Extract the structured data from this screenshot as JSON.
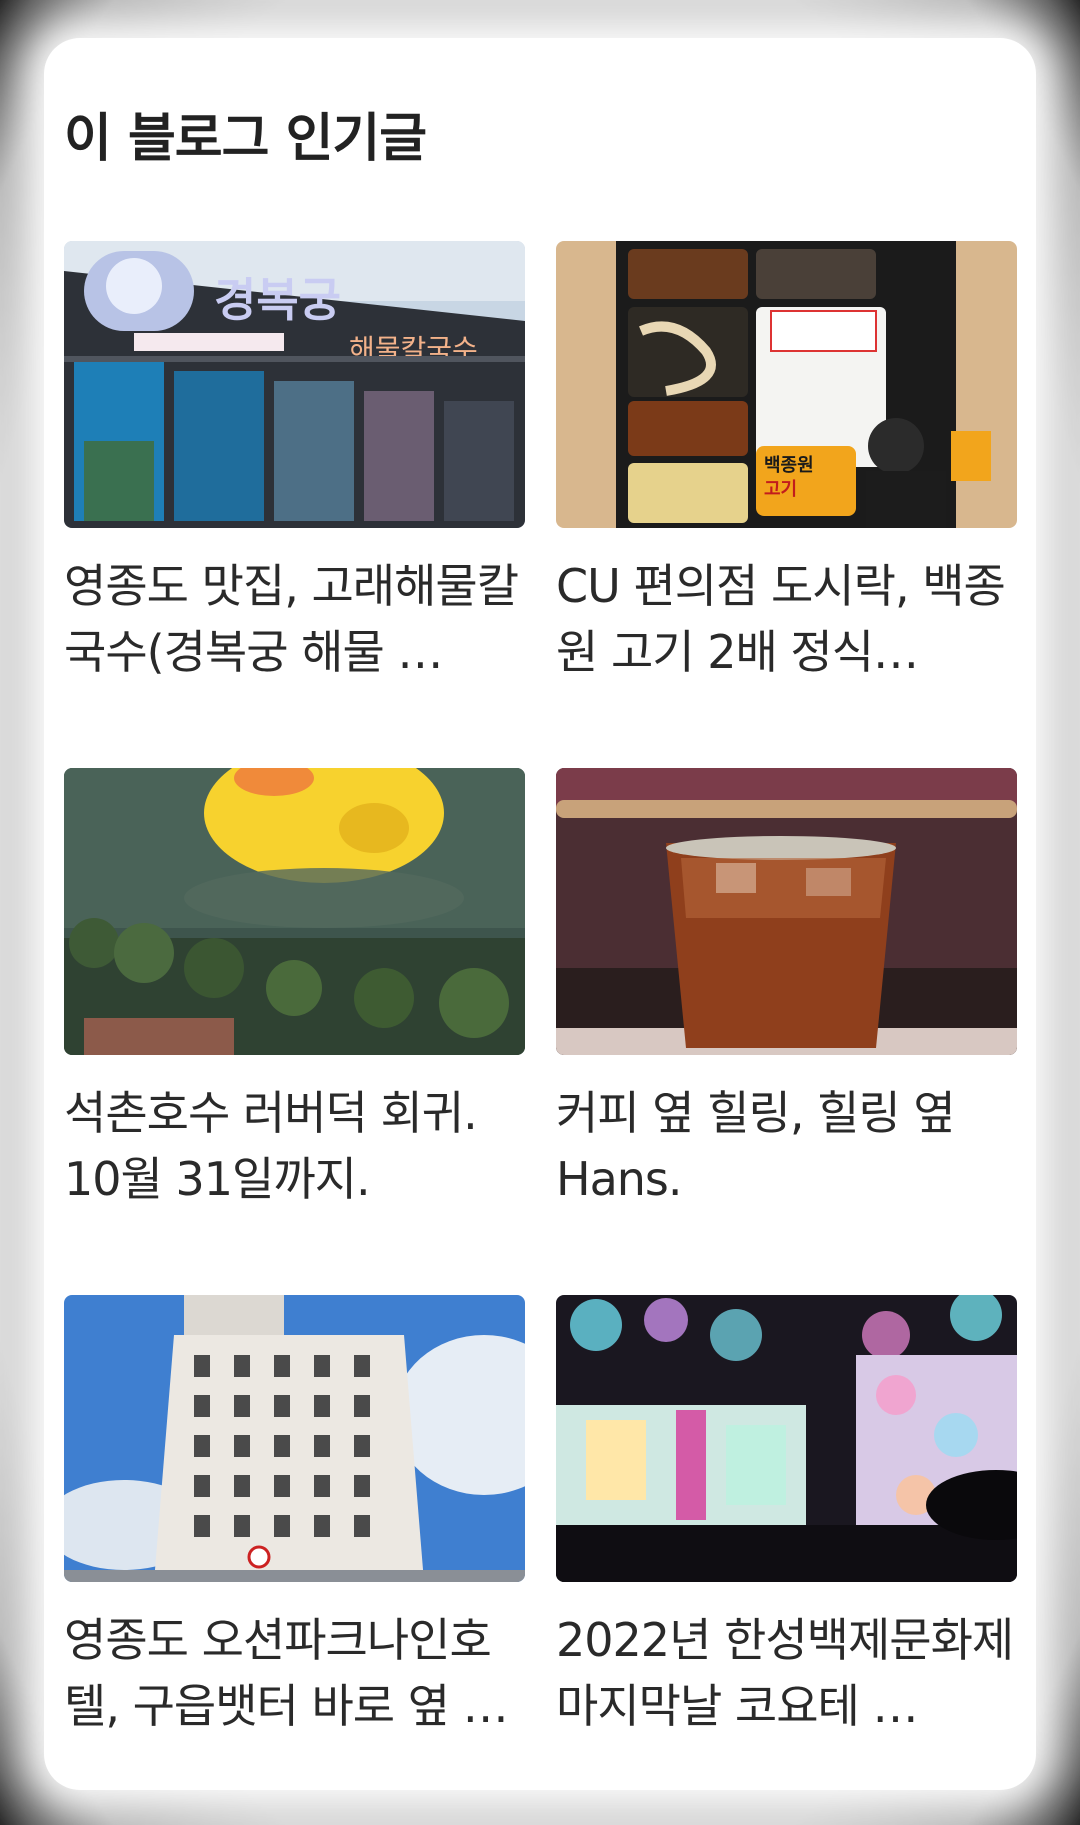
{
  "section": {
    "title": "이 블로그 인기글"
  },
  "posts": [
    {
      "title": "영종도 맛집, 고래해물칼국수(경복궁 해물 …",
      "thumbnail": "restaurant-storefront-image"
    },
    {
      "title": "CU 편의점 도시락, 백종원 고기 2배 정식…",
      "thumbnail": "lunchbox-image"
    },
    {
      "title": "석촌호수 러버덕 회귀. 10월 31일까지.",
      "thumbnail": "rubber-duck-lake-image"
    },
    {
      "title": "커피 옆 힐링, 힐링 옆 Hans.",
      "thumbnail": "iced-coffee-image"
    },
    {
      "title": "영종도 오션파크나인호텔, 구읍뱃터 바로 옆 …",
      "thumbnail": "hotel-building-image"
    },
    {
      "title": "2022년 한성백제문화제 마지막날 코요테 …",
      "thumbnail": "concert-stage-image"
    }
  ]
}
